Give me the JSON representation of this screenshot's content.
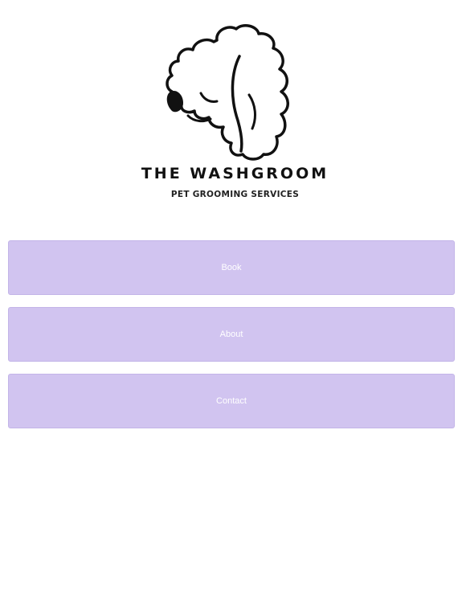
{
  "brand": {
    "name": "THE WASHGROOM",
    "tagline": "PET GROOMING SERVICES",
    "logo_icon": "poodle-head-outline-icon"
  },
  "nav": {
    "buttons": [
      {
        "label": "Book"
      },
      {
        "label": "About"
      },
      {
        "label": "Contact"
      }
    ]
  },
  "colors": {
    "button_bg": "#d1c4f0",
    "button_text": "#ffffff",
    "page_bg": "#ffffff",
    "logo_ink": "#111111"
  }
}
